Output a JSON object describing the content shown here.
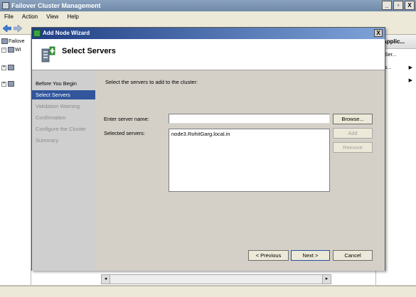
{
  "app": {
    "title": "Failover Cluster Management"
  },
  "window_controls": {
    "minimize": "_",
    "maximize": "▫",
    "close": "X"
  },
  "menu": [
    "File",
    "Action",
    "View",
    "Help"
  ],
  "tree": {
    "root_label": "Failove",
    "child_label": "WI"
  },
  "actions": {
    "header": "Applic...",
    "items": [
      "Ser...",
      "s...",
      ""
    ]
  },
  "dialog": {
    "title": "Add Node Wizard",
    "close_label": "X",
    "header_title": "Select Servers",
    "nav": [
      {
        "label": "Before You Begin",
        "state": "normal"
      },
      {
        "label": "Select Servers",
        "state": "selected"
      },
      {
        "label": "Validation Warning",
        "state": "disabled"
      },
      {
        "label": "Confirmation",
        "state": "disabled"
      },
      {
        "label": "Configure the Cluster",
        "state": "disabled"
      },
      {
        "label": "Summary",
        "state": "disabled"
      }
    ],
    "instruction": "Select the servers to add to the cluster:",
    "server_name_label": "Enter server name:",
    "server_name_value": "",
    "selected_servers_label": "Selected servers:",
    "selected_servers": [
      "node3.RohitGarg.local.in"
    ],
    "browse_label": "Browse...",
    "add_label": "Add",
    "remove_label": "Remove",
    "previous_label": "< Previous",
    "next_label": "Next >",
    "cancel_label": "Cancel"
  },
  "colors": {
    "dialog_title_start": "#1f3e84",
    "dialog_title_end": "#7fa3d8",
    "nav_selected": "#31569c"
  }
}
